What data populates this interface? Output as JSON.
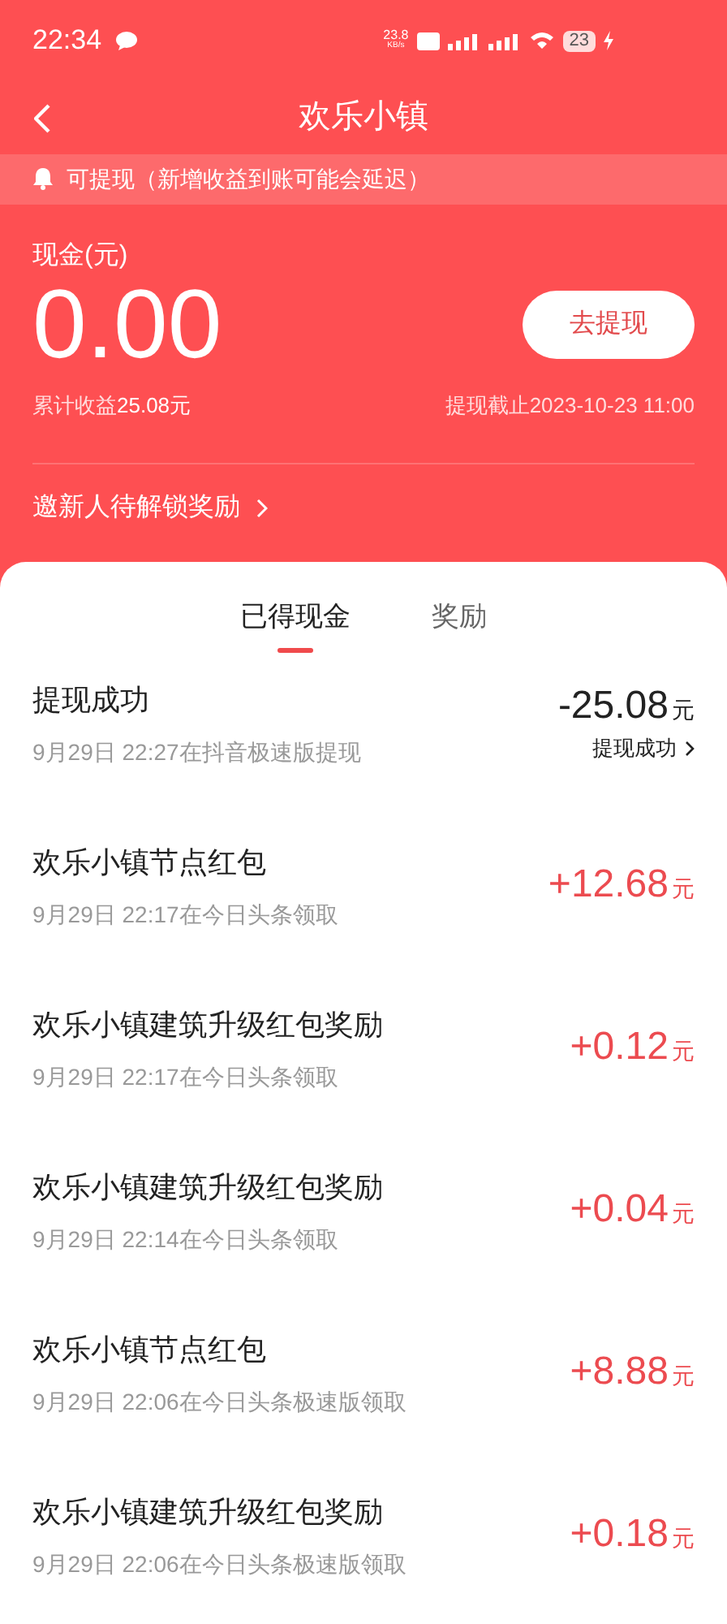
{
  "status_bar": {
    "time": "22:34",
    "net_speed": "23.8",
    "net_unit": "KB/s",
    "battery": "23"
  },
  "nav": {
    "title": "欢乐小镇"
  },
  "notice": {
    "text": "可提现（新增收益到账可能会延迟）"
  },
  "cash": {
    "label": "现金(元)",
    "amount": "0.00",
    "button": "去提现",
    "total_label": "累计收益",
    "total_value": "25.08元",
    "deadline": "提现截止2023-10-23 11:00"
  },
  "invite": {
    "text": "邀新人待解锁奖励"
  },
  "tabs": [
    {
      "label": "已得现金",
      "selected": true
    },
    {
      "label": "奖励",
      "selected": false
    }
  ],
  "records": [
    {
      "kind": "withdrawal",
      "title": "提现成功",
      "subtitle": "9月29日 22:27在抖音极速版提现",
      "amount": "-25.08",
      "unit": "元",
      "status": "提现成功"
    },
    {
      "kind": "income",
      "title": "欢乐小镇节点红包",
      "subtitle": "9月29日 22:17在今日头条领取",
      "amount": "+12.68",
      "unit": "元"
    },
    {
      "kind": "income",
      "title": "欢乐小镇建筑升级红包奖励",
      "subtitle": "9月29日 22:17在今日头条领取",
      "amount": "+0.12",
      "unit": "元"
    },
    {
      "kind": "income",
      "title": "欢乐小镇建筑升级红包奖励",
      "subtitle": "9月29日 22:14在今日头条领取",
      "amount": "+0.04",
      "unit": "元"
    },
    {
      "kind": "income",
      "title": "欢乐小镇节点红包",
      "subtitle": "9月29日 22:06在今日头条极速版领取",
      "amount": "+8.88",
      "unit": "元"
    },
    {
      "kind": "income",
      "title": "欢乐小镇建筑升级红包奖励",
      "subtitle": "9月29日 22:06在今日头条极速版领取",
      "amount": "+0.18",
      "unit": "元"
    }
  ]
}
